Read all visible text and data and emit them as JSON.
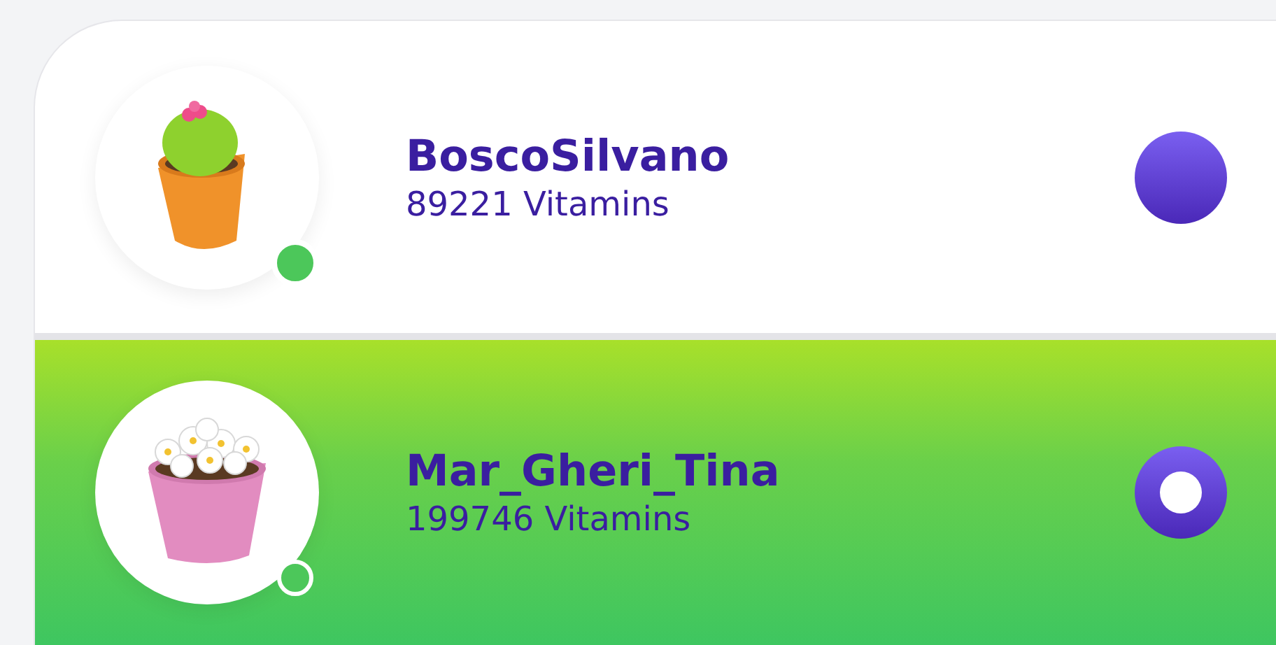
{
  "users": [
    {
      "name": "BoscoSilvano",
      "score": "89221 Vitamins",
      "kind": "cactus",
      "color": "#4cc75a",
      "selected": false
    },
    {
      "name": "Mar_Gheri_Tina",
      "score": "199746 Vitamins",
      "kind": "daisies",
      "color": "#4cc75a",
      "selected": true
    }
  ]
}
